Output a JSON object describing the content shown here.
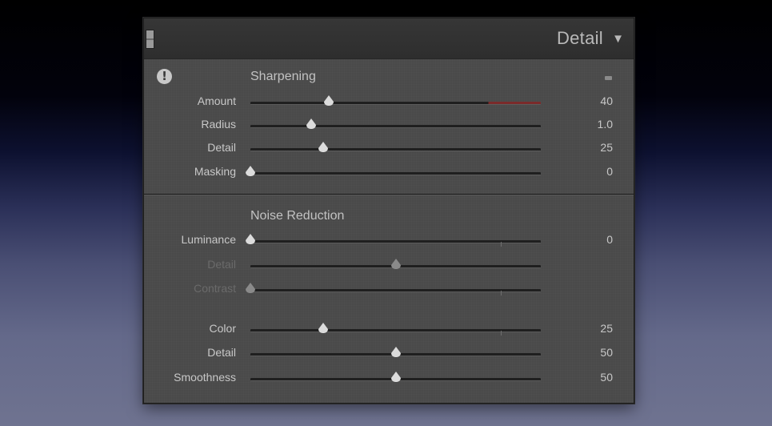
{
  "panel": {
    "title": "Detail",
    "collapse_icon": "▼",
    "sharpening": {
      "heading": "Sharpening",
      "warning_icon": "!",
      "sliders": [
        {
          "label": "Amount",
          "value": "40",
          "fraction": 0.27
        },
        {
          "label": "Radius",
          "value": "1.0",
          "fraction": 0.21
        },
        {
          "label": "Detail",
          "value": "25",
          "fraction": 0.25
        },
        {
          "label": "Masking",
          "value": "0",
          "fraction": 0.0
        }
      ]
    },
    "noise_reduction": {
      "heading": "Noise Reduction",
      "sliders": [
        {
          "label": "Luminance",
          "value": "0",
          "fraction": 0.0,
          "enabled": true
        },
        {
          "label": "Detail",
          "value": "",
          "fraction": 0.5,
          "enabled": false
        },
        {
          "label": "Contrast",
          "value": "",
          "fraction": 0.0,
          "enabled": false
        },
        {
          "label": "Color",
          "value": "25",
          "fraction": 0.25,
          "enabled": true
        },
        {
          "label": "Detail",
          "value": "50",
          "fraction": 0.5,
          "enabled": true
        },
        {
          "label": "Smoothness",
          "value": "50",
          "fraction": 0.5,
          "enabled": true
        }
      ]
    }
  }
}
